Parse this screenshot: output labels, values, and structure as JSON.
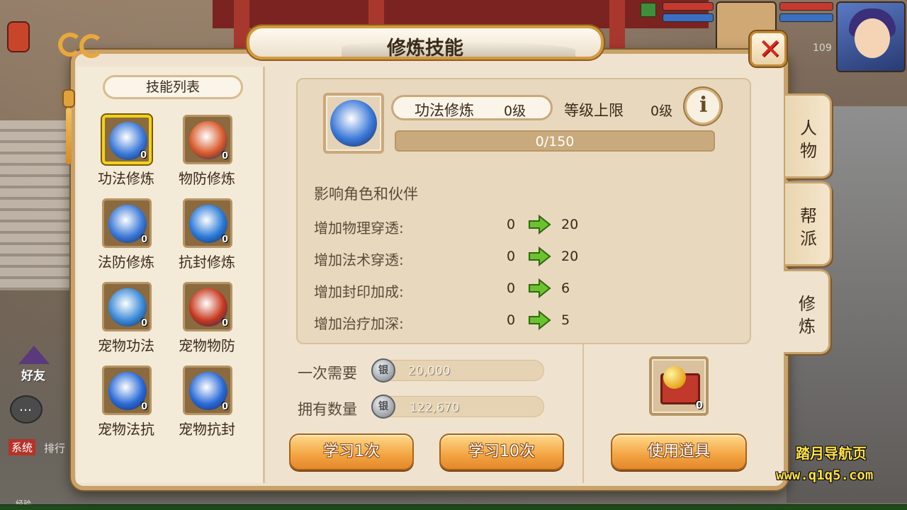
{
  "window": {
    "title": "修炼技能"
  },
  "skill_list": {
    "header": "技能列表",
    "items": [
      {
        "label": "功法修炼",
        "count": "0",
        "color": "#3a78d8",
        "selected": true
      },
      {
        "label": "物防修炼",
        "count": "0",
        "color": "#d8582a",
        "selected": false
      },
      {
        "label": "法防修炼",
        "count": "0",
        "color": "#3a78d8",
        "selected": false
      },
      {
        "label": "抗封修炼",
        "count": "0",
        "color": "#2a7ad8",
        "selected": false
      },
      {
        "label": "宠物功法",
        "count": "0",
        "color": "#3a8ad8",
        "selected": false
      },
      {
        "label": "宠物物防",
        "count": "0",
        "color": "#c8381e",
        "selected": false
      },
      {
        "label": "宠物法抗",
        "count": "0",
        "color": "#2a6ad8",
        "selected": false
      },
      {
        "label": "宠物抗封",
        "count": "0",
        "color": "#2a6ad8",
        "selected": false
      }
    ]
  },
  "detail": {
    "skill_name": "功法修炼",
    "skill_level": "0级",
    "cap_label": "等级上限",
    "cap_value": "0级",
    "progress_text": "0/150",
    "progress_fraction": 0,
    "affect_label": "影响角色和伙伴",
    "stats": [
      {
        "label": "增加物理穿透:",
        "from": "0",
        "to": "20"
      },
      {
        "label": "增加法术穿透:",
        "from": "0",
        "to": "20"
      },
      {
        "label": "增加封印加成:",
        "from": "0",
        "to": "6"
      },
      {
        "label": "增加治疗加深:",
        "from": "0",
        "to": "5"
      }
    ]
  },
  "cost": {
    "need_label": "一次需要",
    "need_value": "20,000",
    "own_label": "拥有数量",
    "own_value": "122,670",
    "coin_icon": "silver-coin-icon"
  },
  "buttons": {
    "learn_once": "学习1次",
    "learn_ten": "学习10次",
    "use_item": "使用道具"
  },
  "item_slot": {
    "count": "0"
  },
  "tabs": [
    {
      "label": "人物",
      "active": false
    },
    {
      "label": "帮派",
      "active": false
    },
    {
      "label": "修炼",
      "active": true
    }
  ],
  "hud": {
    "level": "109",
    "friend_label": "好友",
    "sys_tag": "系统",
    "rank_text": "排行",
    "exp_label": "经验"
  },
  "watermark": {
    "title": "踏月导航页",
    "url": "www.q1q5.com"
  },
  "colors": {
    "accent_orange": "#f3a441",
    "frame_gold": "#c9a26a",
    "panel_bg": "#efe3cf",
    "close_red": "#d7261e",
    "arrow_green": "#6cc22e",
    "watermark_yellow": "#ffe24a"
  }
}
